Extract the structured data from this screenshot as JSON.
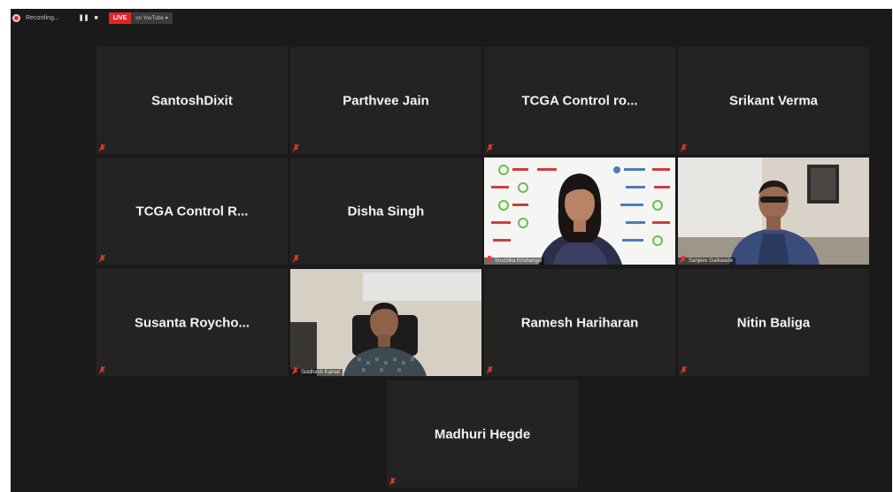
{
  "recording": {
    "label": "Recording...",
    "live": "LIVE",
    "stream_target": "on YouTube"
  },
  "participants": [
    {
      "name": "SantoshDixit"
    },
    {
      "name": "Parthvee Jain"
    },
    {
      "name": "TCGA  Control ro..."
    },
    {
      "name": "Srikant Verma"
    },
    {
      "name": "TCGA  Control R..."
    },
    {
      "name": "Disha Singh"
    },
    {
      "name": "Sruchika Krishangel"
    },
    {
      "name": "Sanjeev Gaikwade"
    },
    {
      "name": "Susanta  Roycho..."
    },
    {
      "name": "Siddhesh Kamat"
    },
    {
      "name": "Ramesh Hariharan"
    },
    {
      "name": "Nitin Baliga"
    },
    {
      "name": "Madhuri Hegde"
    }
  ],
  "colors": {
    "background": "#1a1a1a",
    "tile": "#232323",
    "active_speaker": "#c8d84a",
    "live": "#e02626",
    "muted_icon": "#e03a2e"
  }
}
